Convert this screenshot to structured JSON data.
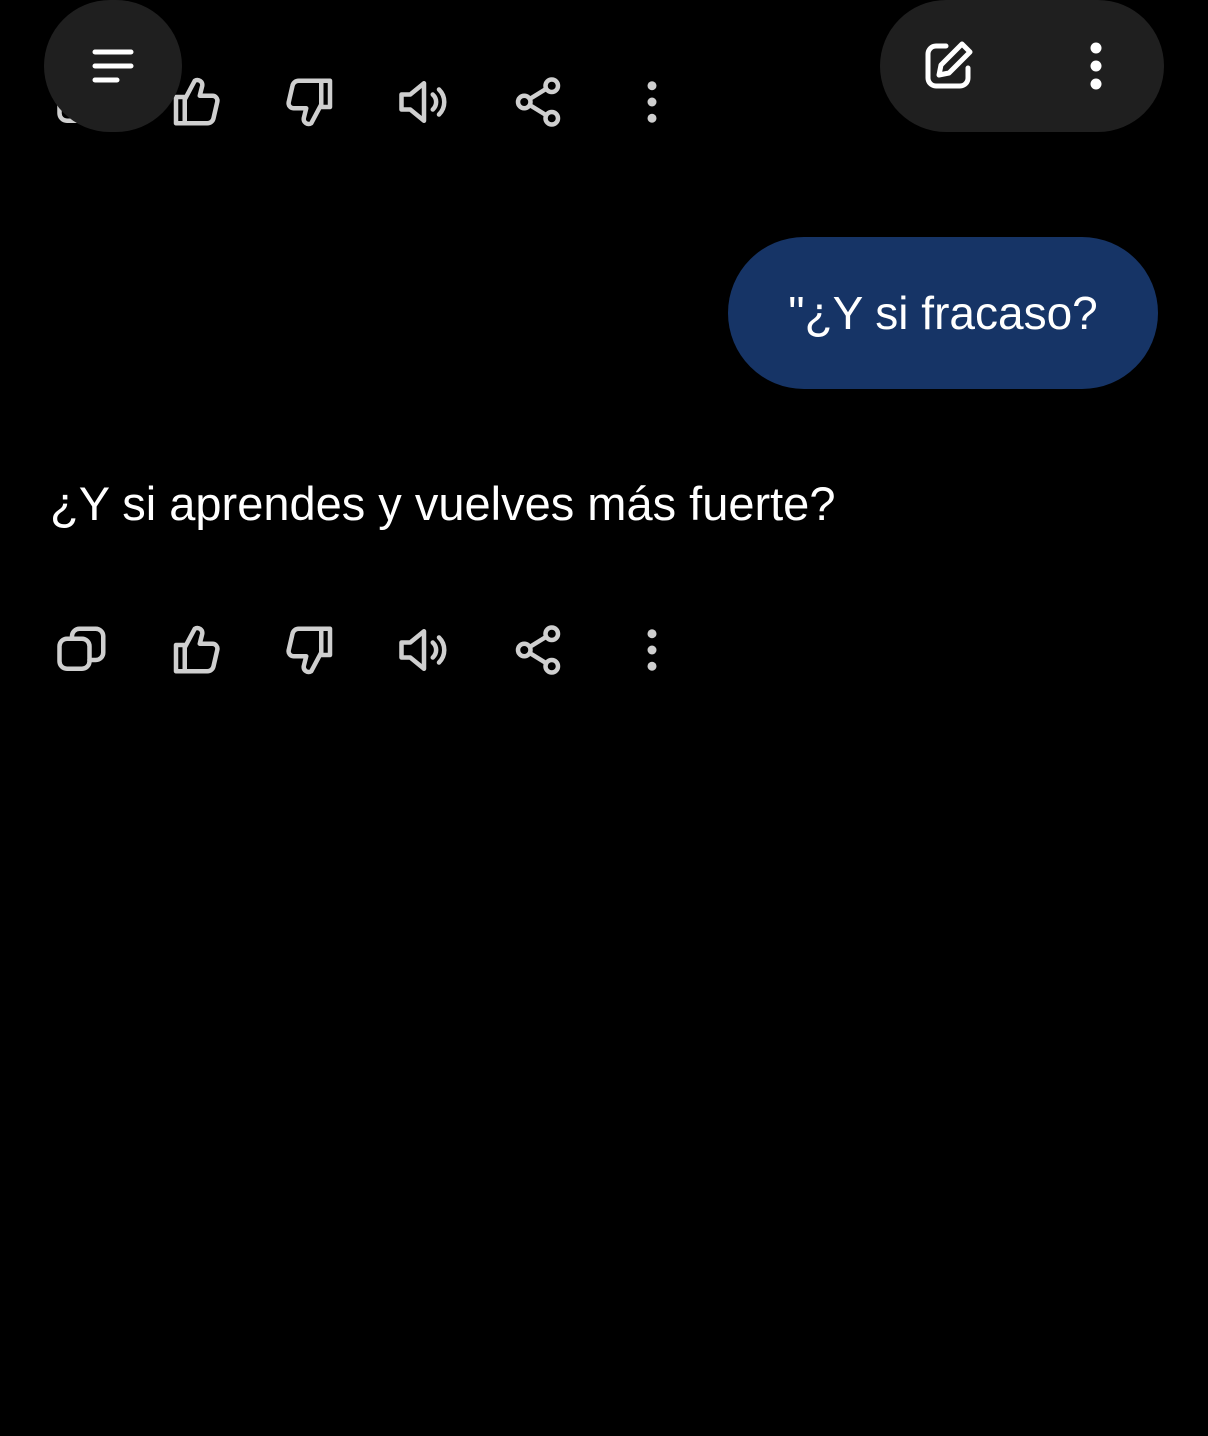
{
  "messages": {
    "user": "\"¿Y si fracaso?",
    "assistant": "¿Y si aprendes y vuelves más fuerte?"
  },
  "actions": {
    "copy": "copy-icon",
    "like": "thumbs-up-icon",
    "dislike": "thumbs-down-icon",
    "read_aloud": "speaker-icon",
    "share": "share-icon",
    "more": "more-vertical-icon"
  },
  "header": {
    "menu": "menu-icon",
    "new_chat": "edit-icon",
    "options": "more-vertical-icon"
  },
  "colors": {
    "background": "#000000",
    "user_bubble": "#163466",
    "fab": "#1f1f1f",
    "icon": "#cfcfcf"
  }
}
